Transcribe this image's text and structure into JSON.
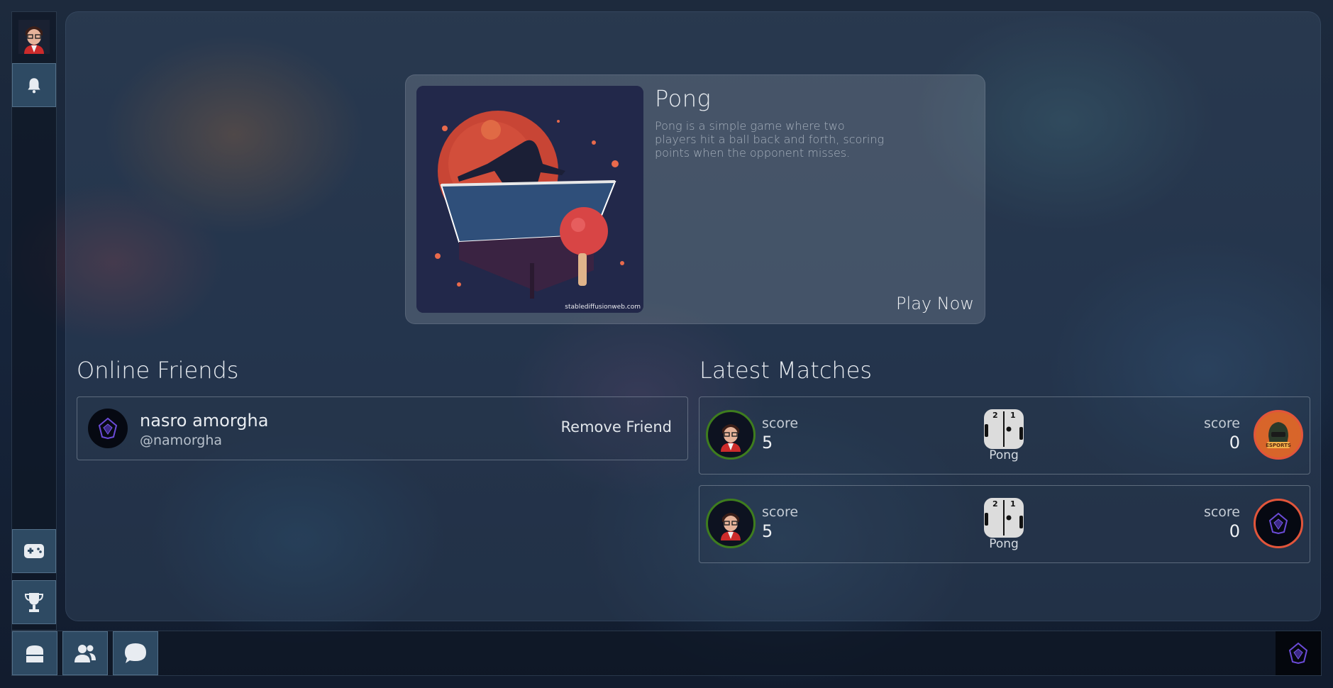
{
  "game": {
    "title": "Pong",
    "description": "Pong is a simple game where two players hit a ball back and forth, scoring points when the opponent misses.",
    "play_label": "Play Now",
    "image_credit": "stablediffusionweb.com"
  },
  "friends": {
    "heading": "Online Friends",
    "items": [
      {
        "name": "nasro amorgha",
        "handle": "@namorgha",
        "action": "Remove Friend"
      }
    ]
  },
  "matches": {
    "heading": "Latest Matches",
    "items": [
      {
        "left_score_label": "score",
        "left_score": "5",
        "game": "Pong",
        "right_score_label": "score",
        "right_score": "0",
        "right_avatar": "esports-avatar"
      },
      {
        "left_score_label": "score",
        "left_score": "5",
        "game": "Pong",
        "right_score_label": "score",
        "right_score": "0",
        "right_avatar": "shield-avatar"
      }
    ]
  },
  "colors": {
    "winner_ring": "#3e7d1e",
    "loser_ring": "#e2553b",
    "accent_blue": "#2e4a63"
  },
  "icons": {
    "sidebar": [
      "user-avatar",
      "bell-icon",
      "gamepad-icon",
      "trophy-icon"
    ],
    "bottombar": [
      "home-icon",
      "friends-icon",
      "chat-icon",
      "shield-logo-icon"
    ]
  }
}
